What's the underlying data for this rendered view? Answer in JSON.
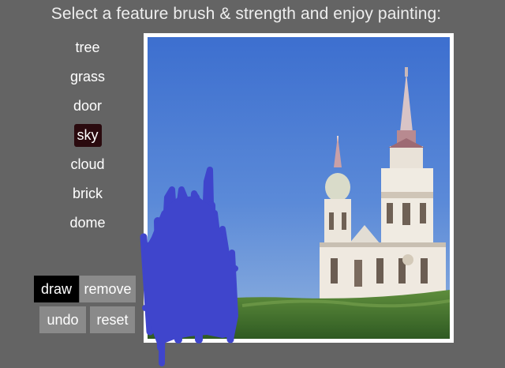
{
  "header": {
    "title": "Select a feature brush & strength and enjoy painting:"
  },
  "brushes": [
    {
      "label": "tree"
    },
    {
      "label": "grass"
    },
    {
      "label": "door"
    },
    {
      "label": "sky",
      "selected": true
    },
    {
      "label": "cloud"
    },
    {
      "label": "brick"
    },
    {
      "label": "dome"
    }
  ],
  "controls": {
    "draw_label": "draw",
    "remove_label": "remove",
    "undo_label": "undo",
    "reset_label": "reset"
  },
  "colors": {
    "background": "#646464",
    "selected_brush": "#2a0a0e",
    "stroke": "#3f45cc"
  }
}
